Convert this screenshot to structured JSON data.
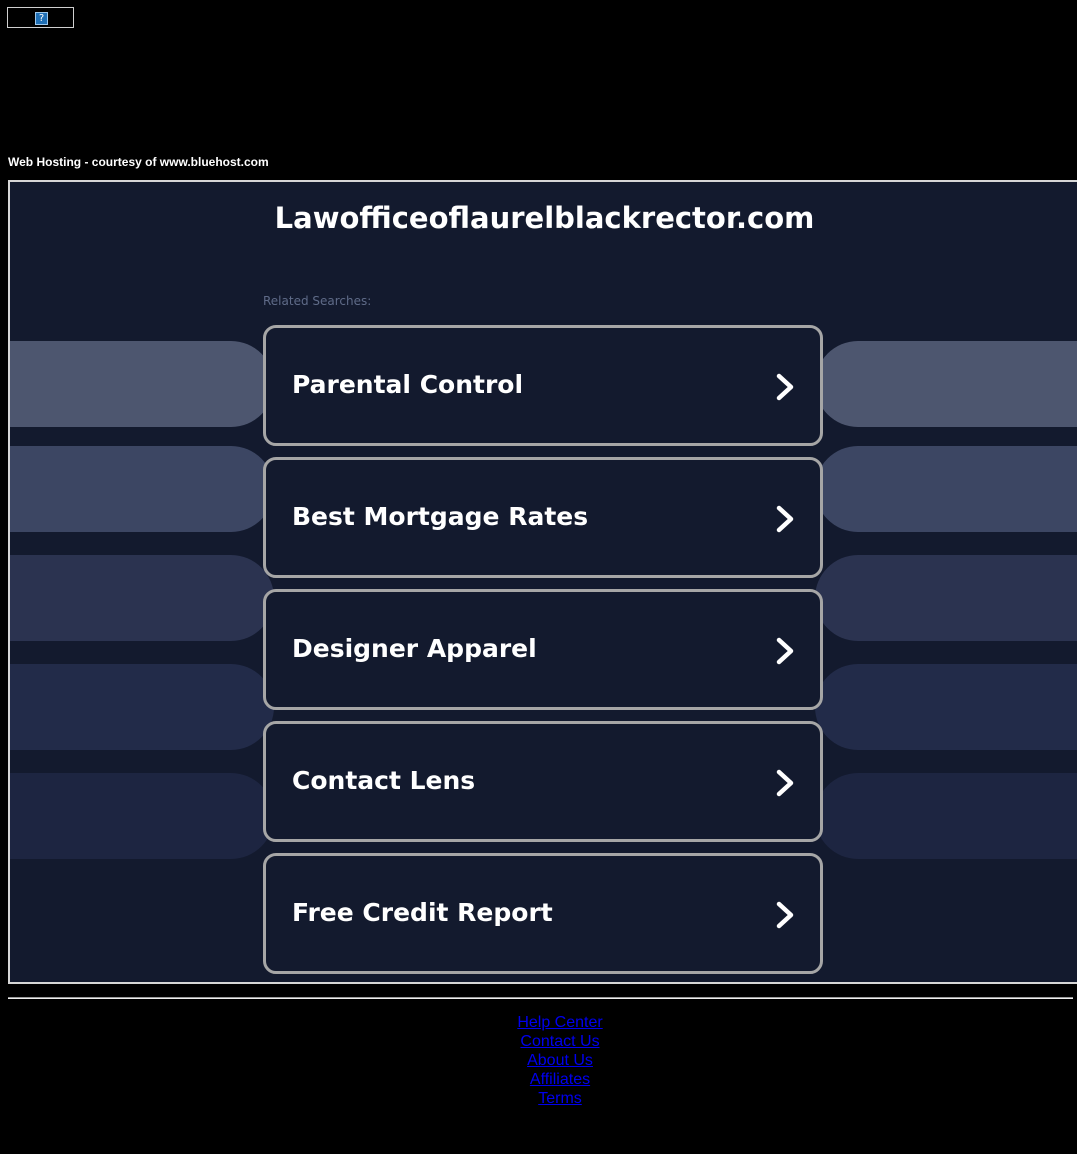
{
  "top_banner": {
    "icon": "help-icon",
    "glyph": "?"
  },
  "hosting_note": "Web Hosting - courtesy of www.bluehost.com",
  "parked_page": {
    "domain_title": "Lawofficeoflaurelblackrector.com",
    "related_label": "Related Searches:",
    "links": [
      {
        "label": "Parental Control",
        "icon": "chevron-right-icon"
      },
      {
        "label": "Best Mortgage Rates",
        "icon": "chevron-right-icon"
      },
      {
        "label": "Designer Apparel",
        "icon": "chevron-right-icon"
      },
      {
        "label": "Contact Lens",
        "icon": "chevron-right-icon"
      },
      {
        "label": "Free Credit Report",
        "icon": "chevron-right-icon"
      }
    ],
    "colors": {
      "background": "#131a2e",
      "link_border": "#a6a6a6",
      "side_pills": [
        "#4d566f",
        "#3c4663",
        "#2b3350",
        "#222b49",
        "#1d2541"
      ]
    }
  },
  "footer": {
    "links": [
      "Help Center",
      "Contact Us",
      "About Us",
      "Affiliates",
      "Terms"
    ],
    "link_color": "#0000ee"
  }
}
